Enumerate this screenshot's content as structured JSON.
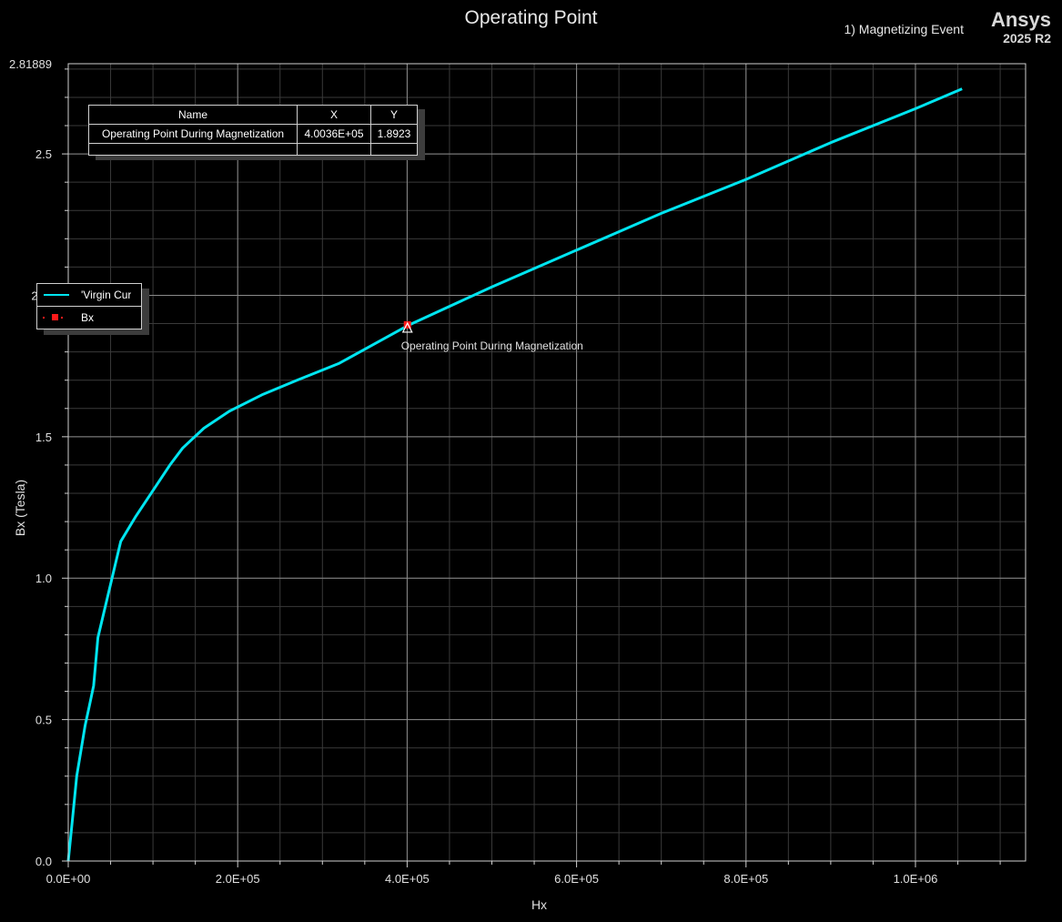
{
  "header": {
    "title": "Operating Point",
    "subtitle": "1) Magnetizing Event",
    "brand_name": "Ansys",
    "brand_version": "2025 R2"
  },
  "marker_table": {
    "headers": [
      "Name",
      "X",
      "Y"
    ],
    "rows": [
      {
        "name": "Operating Point During Magnetization",
        "x": "4.0036E+05",
        "y": "1.8923"
      }
    ]
  },
  "legend": {
    "items": [
      {
        "label": "'Virgin Cur",
        "color": "#00e5f0"
      },
      {
        "label": "Bx",
        "color": "#ff1a1a"
      }
    ]
  },
  "colors": {
    "background": "#000000",
    "grid": "#8a8a8a",
    "curve": "#00e5f0",
    "marker": "#ff1a1a"
  },
  "chart_data": {
    "type": "line",
    "title": "Operating Point",
    "xlabel": "Hx",
    "ylabel": "Bx (Tesla)",
    "xlim": [
      0,
      1130000
    ],
    "ylim": [
      0,
      2.81889
    ],
    "x_ticks": [
      0,
      200000,
      400000,
      600000,
      800000,
      1000000
    ],
    "x_tick_labels": [
      "0.0E+00",
      "2.0E+05",
      "4.0E+05",
      "6.0E+05",
      "8.0E+05",
      "1.0E+06"
    ],
    "y_ticks": [
      0,
      0.5,
      1.0,
      1.5,
      2.5,
      2.81889
    ],
    "y_tick_labels": [
      "0.0",
      "0.5",
      "1.0",
      "1.5",
      "2.5",
      "2.81889"
    ],
    "y_partial_label": {
      "value": 2.0,
      "text": "2"
    },
    "grid": true,
    "legend_position": "left",
    "series": [
      {
        "name": "'Virgin Cur",
        "x": [
          0,
          5000,
          10000,
          20000,
          25000,
          30000,
          35000,
          62000,
          80000,
          100000,
          120000,
          135000,
          160000,
          190000,
          230000,
          270000,
          320000,
          400360,
          500000,
          600000,
          700000,
          800000,
          900000,
          1000000,
          1055000
        ],
        "y": [
          0,
          0.15,
          0.3,
          0.48,
          0.55,
          0.62,
          0.79,
          1.13,
          1.22,
          1.31,
          1.4,
          1.46,
          1.53,
          1.59,
          1.65,
          1.7,
          1.76,
          1.8923,
          2.03,
          2.16,
          2.29,
          2.41,
          2.54,
          2.66,
          2.73
        ]
      }
    ],
    "markers": [
      {
        "name": "Bx",
        "label": "Operating Point During Magnetization",
        "x": 400360,
        "y": 1.8923
      }
    ]
  }
}
